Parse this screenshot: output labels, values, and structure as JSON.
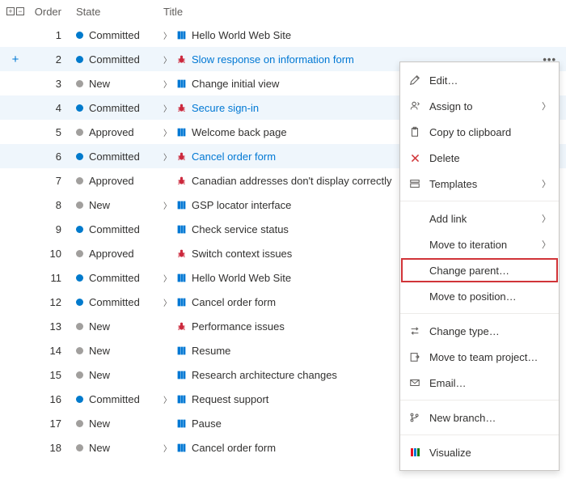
{
  "columns": {
    "order": "Order",
    "state": "State",
    "title": "Title"
  },
  "states": {
    "committed": "Committed",
    "new": "New",
    "approved": "Approved"
  },
  "rows": [
    {
      "order": "1",
      "state": "committed",
      "dot": "blue",
      "type": "pbi",
      "chev": true,
      "title": "Hello World Web Site",
      "hl": false,
      "link": false
    },
    {
      "order": "2",
      "state": "committed",
      "dot": "blue",
      "type": "bug",
      "chev": true,
      "title": "Slow response on information form",
      "hl": true,
      "more": true,
      "plus": true,
      "link": true
    },
    {
      "order": "3",
      "state": "new",
      "dot": "gray",
      "type": "pbi",
      "chev": true,
      "title": "Change initial view",
      "hl": false,
      "link": false
    },
    {
      "order": "4",
      "state": "committed",
      "dot": "blue",
      "type": "bug",
      "chev": true,
      "title": "Secure sign-in",
      "hl": true,
      "more": true,
      "link": true
    },
    {
      "order": "5",
      "state": "approved",
      "dot": "gray",
      "type": "pbi",
      "chev": true,
      "title": "Welcome back page",
      "hl": false,
      "link": false
    },
    {
      "order": "6",
      "state": "committed",
      "dot": "blue",
      "type": "bug",
      "chev": true,
      "title": "Cancel order form",
      "hl": true,
      "more": true,
      "link": true
    },
    {
      "order": "7",
      "state": "approved",
      "dot": "gray",
      "type": "bug",
      "chev": false,
      "title": "Canadian addresses don't display correctly",
      "hl": false,
      "link": false
    },
    {
      "order": "8",
      "state": "new",
      "dot": "gray",
      "type": "pbi",
      "chev": true,
      "title": "GSP locator interface",
      "hl": false,
      "link": false
    },
    {
      "order": "9",
      "state": "committed",
      "dot": "blue",
      "type": "pbi",
      "chev": false,
      "title": "Check service status",
      "hl": false,
      "link": false
    },
    {
      "order": "10",
      "state": "approved",
      "dot": "gray",
      "type": "bug",
      "chev": false,
      "title": "Switch context issues",
      "hl": false,
      "link": false
    },
    {
      "order": "11",
      "state": "committed",
      "dot": "blue",
      "type": "pbi",
      "chev": true,
      "title": "Hello World Web Site",
      "hl": false,
      "link": false
    },
    {
      "order": "12",
      "state": "committed",
      "dot": "blue",
      "type": "pbi",
      "chev": true,
      "title": "Cancel order form",
      "hl": false,
      "link": false
    },
    {
      "order": "13",
      "state": "new",
      "dot": "gray",
      "type": "bug",
      "chev": false,
      "title": "Performance issues",
      "hl": false,
      "link": false
    },
    {
      "order": "14",
      "state": "new",
      "dot": "gray",
      "type": "pbi",
      "chev": false,
      "title": "Resume",
      "hl": false,
      "link": false
    },
    {
      "order": "15",
      "state": "new",
      "dot": "gray",
      "type": "pbi",
      "chev": false,
      "title": "Research architecture changes",
      "hl": false,
      "link": false
    },
    {
      "order": "16",
      "state": "committed",
      "dot": "blue",
      "type": "pbi",
      "chev": true,
      "title": "Request support",
      "hl": false,
      "link": false
    },
    {
      "order": "17",
      "state": "new",
      "dot": "gray",
      "type": "pbi",
      "chev": false,
      "title": "Pause",
      "hl": false,
      "link": false
    },
    {
      "order": "18",
      "state": "new",
      "dot": "gray",
      "type": "pbi",
      "chev": true,
      "title": "Cancel order form",
      "hl": false,
      "link": false
    }
  ],
  "menu": {
    "edit": "Edit…",
    "assign_to": "Assign to",
    "copy": "Copy to clipboard",
    "delete": "Delete",
    "templates": "Templates",
    "add_link": "Add link",
    "move_iteration": "Move to iteration",
    "change_parent": "Change parent…",
    "move_position": "Move to position…",
    "change_type": "Change type…",
    "move_team_project": "Move to team project…",
    "email": "Email…",
    "new_branch": "New branch…",
    "visualize": "Visualize"
  }
}
